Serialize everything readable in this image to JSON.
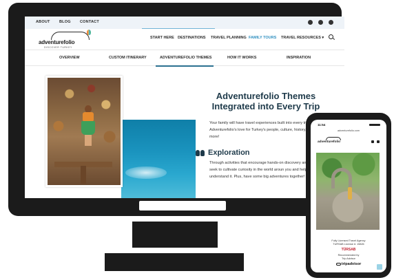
{
  "desktop": {
    "topbar": {
      "links": [
        "ABOUT",
        "BLOG",
        "CONTACT"
      ],
      "social_icons": [
        "instagram-icon",
        "facebook-icon",
        "pinterest-icon"
      ]
    },
    "header": {
      "logo_text": "adventurefolio",
      "logo_sub": "DISCOVER TURKEY",
      "nav": [
        "START HERE",
        "DESTINATIONS",
        "TRAVEL PLANNING",
        "FAMILY TOURS",
        "TRAVEL RESOURCES ▾"
      ],
      "active_nav_index": 3,
      "accent_color": "#2e8fc0"
    },
    "subnav": {
      "items": [
        "OVERVIEW",
        "CUSTOM ITINERARY",
        "ADVENTUREFOLIO THEMES",
        "HOW IT WORKS",
        "INSPIRATION"
      ],
      "active_index": 2
    },
    "content": {
      "headline": "Adventurefolio Themes Integrated into Every Trip",
      "intro": "Your family will have travel experiences built into every trip inspired by Adventurefolio's love for Turkey's people, culture, history, adventures and more!",
      "section_title": "Exploration",
      "section_icon": "binoculars-icon",
      "section_body": "Through activities that encourage hands-on discovery and lo engagement, we seek to cultivate curiosity in the world aroun you and help you better understand it. Plus, have some big adventures together!"
    }
  },
  "phone": {
    "time": "11:54",
    "url": "adventurefolio.com",
    "logo_text": "adventurefolio",
    "license_line1": "Fully Licensed Travel Agency",
    "license_line2": "TURSAB License #: 15826",
    "tursab": "TÜRSAB",
    "recommended_line1": "Recommended by",
    "recommended_line2": "Trip Advisor",
    "tripadvisor": "tripadvisor"
  }
}
